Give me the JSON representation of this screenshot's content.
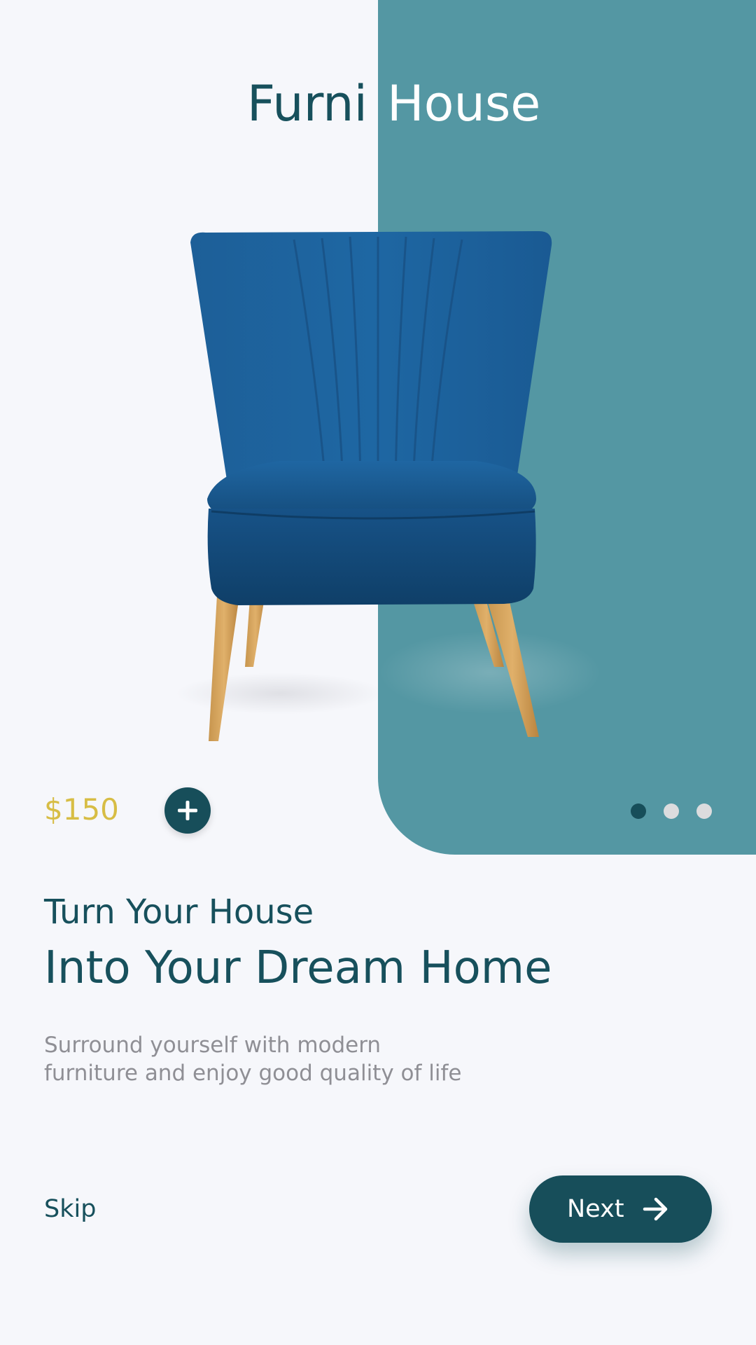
{
  "app": {
    "brand_part1": "Furni",
    "brand_part2": "House"
  },
  "product": {
    "name": "blue velvet armchair",
    "price": "$150",
    "add_icon": "plus-icon"
  },
  "pagination": {
    "total": 3,
    "active_index": 0,
    "active_color": "#174e5a",
    "inactive_color": "#dcdcde"
  },
  "content": {
    "subtitle": "Turn Your House",
    "headline": "Into Your Dream Home",
    "description_line1": "Surround yourself with modern",
    "description_line2": "furniture and enjoy good quality of life"
  },
  "actions": {
    "skip_label": "Skip",
    "next_label": "Next",
    "next_icon": "arrow-right-icon"
  },
  "colors": {
    "background": "#f6f7fb",
    "panel": "#5497a3",
    "primary": "#174e5a",
    "price": "#d7bd45",
    "muted_text": "#8f8f95"
  }
}
